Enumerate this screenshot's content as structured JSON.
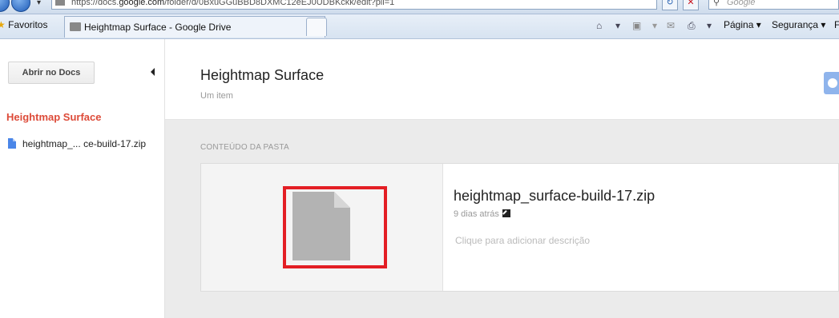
{
  "browser": {
    "url_prefix": "https://docs.",
    "url_domain": "google.com",
    "url_path": "/folder/d/0BxuGGuBBD8DXMC12eEJ0UDBKckk/edit?pli=1",
    "search_placeholder": "Google",
    "favorites_label": "Favoritos",
    "tab_title": "Heightmap Surface - Google Drive",
    "commands": {
      "page": "Página",
      "safety": "Segurança",
      "tools_initial": "F"
    }
  },
  "sidebar": {
    "open_button": "Abrir no Docs",
    "folder_name": "Heightmap Surface",
    "file_label_start": "heightmap_...",
    "file_label_end": "ce-build-17.zip"
  },
  "header": {
    "title": "Heightmap Surface",
    "subtitle": "Um item"
  },
  "content": {
    "section_label": "CONTEÚDO DA PASTA",
    "file": {
      "name": "heightmap_surface-build-17.zip",
      "modified": "9 dias atrás",
      "description_placeholder": "Clique para adicionar descrição"
    }
  },
  "colors": {
    "folder_title": "#dd4b39",
    "highlight_box": "#e31e24",
    "file_icon": "#b3b3b3"
  }
}
